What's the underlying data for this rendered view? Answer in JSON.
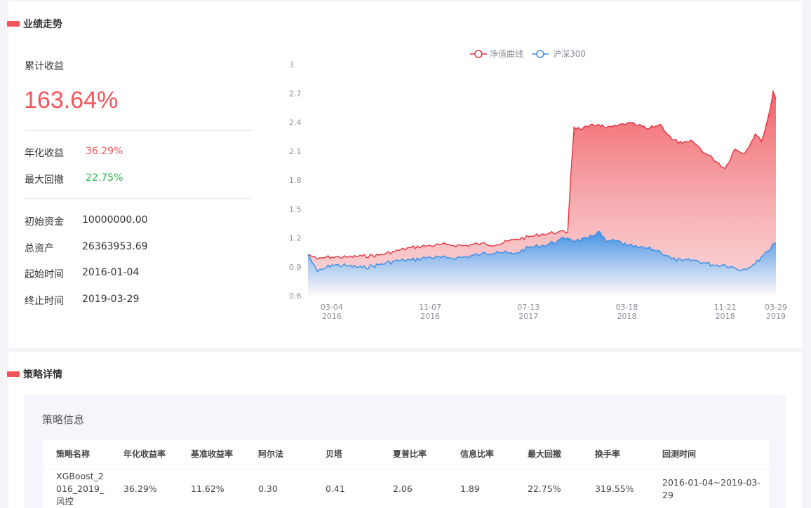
{
  "perf_section": {
    "title": "业绩走势",
    "cum_return_label": "累计收益",
    "cum_return_value": "163.64%",
    "annual_label": "年化收益",
    "annual_value": "36.29%",
    "drawdown_label": "最大回撤",
    "drawdown_value": "22.75%",
    "initial_capital_label": "初始资金",
    "initial_capital_value": "10000000.00",
    "total_assets_label": "总资产",
    "total_assets_value": "26363953.69",
    "start_label": "起始时间",
    "start_value": "2016-01-04",
    "end_label": "终止时间",
    "end_value": "2019-03-29"
  },
  "colors": {
    "accent_red": "#f2545b",
    "positive_red": "#f0575c",
    "negative_green": "#2bb24c",
    "nav_line": "#e8323c",
    "bench_line": "#3a8ee6"
  },
  "chart_data": {
    "type": "area",
    "series": [
      {
        "name": "净值曲线",
        "x": [
          "2016-01-04",
          "2016-01-27",
          "2016-02-19",
          "2016-03-04",
          "2016-04-10",
          "2016-05-20",
          "2016-06-30",
          "2016-08-10",
          "2016-09-20",
          "2016-11-07",
          "2016-12-20",
          "2017-02-01",
          "2017-03-15",
          "2017-04-25",
          "2017-06-05",
          "2017-07-13",
          "2017-08-20",
          "2017-09-25",
          "2017-10-20",
          "2017-10-27",
          "2017-11-05",
          "2017-11-20",
          "2017-12-10",
          "2018-01-05",
          "2018-01-25",
          "2018-02-20",
          "2018-03-18",
          "2018-04-15",
          "2018-05-10",
          "2018-06-10",
          "2018-07-10",
          "2018-08-05",
          "2018-09-01",
          "2018-10-01",
          "2018-10-20",
          "2018-11-21",
          "2018-12-15",
          "2019-01-10",
          "2019-02-05",
          "2019-02-20",
          "2019-03-05",
          "2019-03-15",
          "2019-03-22",
          "2019-03-29"
        ],
        "values": [
          1.03,
          0.98,
          1.0,
          1.0,
          1.0,
          1.01,
          1.02,
          1.06,
          1.1,
          1.12,
          1.13,
          1.12,
          1.14,
          1.13,
          1.18,
          1.21,
          1.24,
          1.26,
          1.26,
          1.8,
          2.35,
          2.33,
          2.35,
          2.38,
          2.34,
          2.36,
          2.39,
          2.37,
          2.33,
          2.38,
          2.22,
          2.18,
          2.2,
          2.08,
          2.03,
          1.92,
          2.12,
          2.08,
          2.28,
          2.2,
          2.38,
          2.55,
          2.72,
          2.64
        ]
      },
      {
        "name": "沪深300",
        "x": [
          "2016-01-04",
          "2016-01-27",
          "2016-02-19",
          "2016-03-04",
          "2016-04-10",
          "2016-05-20",
          "2016-06-30",
          "2016-08-10",
          "2016-09-20",
          "2016-11-07",
          "2016-12-20",
          "2017-02-01",
          "2017-03-15",
          "2017-04-25",
          "2017-06-05",
          "2017-07-13",
          "2017-08-20",
          "2017-09-25",
          "2017-10-20",
          "2017-11-10",
          "2017-12-10",
          "2018-01-05",
          "2018-01-25",
          "2018-02-20",
          "2018-03-18",
          "2018-04-15",
          "2018-05-10",
          "2018-06-10",
          "2018-07-10",
          "2018-08-05",
          "2018-09-01",
          "2018-10-01",
          "2018-10-20",
          "2018-11-21",
          "2018-12-15",
          "2019-01-03",
          "2019-02-05",
          "2019-02-20",
          "2019-03-05",
          "2019-03-15",
          "2019-03-22",
          "2019-03-29"
        ],
        "values": [
          1.03,
          0.85,
          0.89,
          0.92,
          0.91,
          0.89,
          0.92,
          0.96,
          0.97,
          1.0,
          0.99,
          1.0,
          1.03,
          1.06,
          1.03,
          1.1,
          1.12,
          1.17,
          1.2,
          1.17,
          1.19,
          1.27,
          1.16,
          1.17,
          1.12,
          1.1,
          1.09,
          1.06,
          0.98,
          0.96,
          0.97,
          0.94,
          0.92,
          0.92,
          0.89,
          0.87,
          0.93,
          1.0,
          1.06,
          1.08,
          1.14,
          1.15
        ]
      }
    ],
    "x_tick_labels": [
      {
        "date": "2016-03-04",
        "line1": "03-04",
        "line2": "2016"
      },
      {
        "date": "2016-11-07",
        "line1": "11-07",
        "line2": "2016"
      },
      {
        "date": "2017-07-13",
        "line1": "07-13",
        "line2": "2017"
      },
      {
        "date": "2018-03-18",
        "line1": "03-18",
        "line2": "2018"
      },
      {
        "date": "2018-11-21",
        "line1": "11-21",
        "line2": "2018"
      },
      {
        "date": "2019-03-29",
        "line1": "03-29",
        "line2": "2019"
      }
    ],
    "y_ticks": [
      0.6,
      0.9,
      1.2,
      1.5,
      1.8,
      2.1,
      2.4,
      2.7,
      3
    ],
    "ylim": [
      0.6,
      3.0
    ],
    "xlim": [
      "2016-01-04",
      "2019-03-29"
    ],
    "legend_position": "top-center",
    "grid": false
  },
  "detail_section": {
    "title": "策略详情",
    "info_title": "策略信息",
    "table": {
      "headers": [
        "策略名称",
        "年化收益率",
        "基准收益率",
        "阿尔法",
        "贝塔",
        "夏普比率",
        "信息比率",
        "最大回撤",
        "换手率",
        "回测时间"
      ],
      "rows": [
        [
          "XGBoost_2016_2019_风控",
          "36.29%",
          "11.62%",
          "0.30",
          "0.41",
          "2.06",
          "1.89",
          "22.75%",
          "319.55%",
          "2016-01-04~2019-03-29"
        ]
      ]
    }
  }
}
